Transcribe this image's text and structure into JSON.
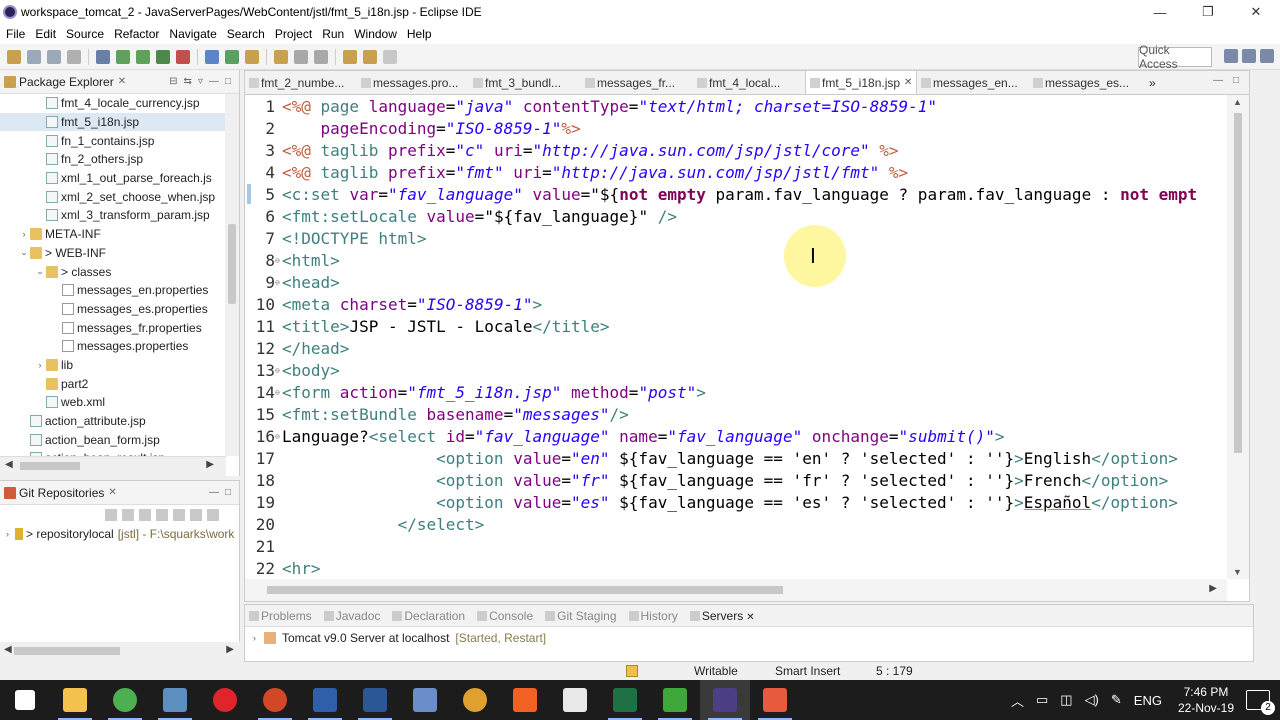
{
  "window": {
    "title": "workspace_tomcat_2 - JavaServerPages/WebContent/jstl/fmt_5_i18n.jsp - Eclipse IDE",
    "minimize": "—",
    "maximize": "❐",
    "close": "✕"
  },
  "menubar": [
    "File",
    "Edit",
    "Source",
    "Refactor",
    "Navigate",
    "Search",
    "Project",
    "Run",
    "Window",
    "Help"
  ],
  "toolbar": {
    "quick_access": "Quick Access"
  },
  "package_explorer": {
    "title": "Package Explorer",
    "items": [
      {
        "label": "fmt_4_locale_currency.jsp",
        "indent": 3,
        "icon": "file-icon",
        "twisty": ""
      },
      {
        "label": "fmt_5_i18n.jsp",
        "indent": 3,
        "icon": "file-icon",
        "twisty": "",
        "selected": true
      },
      {
        "label": "fn_1_contains.jsp",
        "indent": 3,
        "icon": "file-icon",
        "twisty": ""
      },
      {
        "label": "fn_2_others.jsp",
        "indent": 3,
        "icon": "file-icon",
        "twisty": ""
      },
      {
        "label": "xml_1_out_parse_foreach.js",
        "indent": 3,
        "icon": "file-icon",
        "twisty": ""
      },
      {
        "label": "xml_2_set_choose_when.jsp",
        "indent": 3,
        "icon": "file-icon",
        "twisty": ""
      },
      {
        "label": "xml_3_transform_param.jsp",
        "indent": 3,
        "icon": "file-icon",
        "twisty": ""
      },
      {
        "label": "META-INF",
        "indent": 2,
        "icon": "folder-icon",
        "twisty": "›"
      },
      {
        "label": "> WEB-INF",
        "indent": 2,
        "icon": "folder-icon",
        "twisty": "⌄"
      },
      {
        "label": "> classes",
        "indent": 3,
        "icon": "folder-icon",
        "twisty": "⌄"
      },
      {
        "label": "messages_en.properties",
        "indent": 4,
        "icon": "properties-icon",
        "twisty": ""
      },
      {
        "label": "messages_es.properties",
        "indent": 4,
        "icon": "properties-icon",
        "twisty": ""
      },
      {
        "label": "messages_fr.properties",
        "indent": 4,
        "icon": "properties-icon",
        "twisty": ""
      },
      {
        "label": "messages.properties",
        "indent": 4,
        "icon": "properties-icon",
        "twisty": ""
      },
      {
        "label": "lib",
        "indent": 3,
        "icon": "folder-icon",
        "twisty": "›"
      },
      {
        "label": "part2",
        "indent": 3,
        "icon": "folder-icon",
        "twisty": ""
      },
      {
        "label": "web.xml",
        "indent": 3,
        "icon": "file-icon",
        "twisty": ""
      },
      {
        "label": "action_attribute.jsp",
        "indent": 2,
        "icon": "file-icon",
        "twisty": ""
      },
      {
        "label": "action_bean_form.jsp",
        "indent": 2,
        "icon": "file-icon",
        "twisty": ""
      },
      {
        "label": "action_bean_result.jsp",
        "indent": 2,
        "icon": "file-icon",
        "twisty": ""
      }
    ]
  },
  "git_repositories": {
    "title": "Git Repositories",
    "repo_label": "> repositorylocal",
    "repo_detail": "[jstl] - F:\\squarks\\work"
  },
  "editor": {
    "tabs": [
      {
        "label": "fmt_2_numbe...",
        "active": false
      },
      {
        "label": "messages.pro...",
        "active": false
      },
      {
        "label": "fmt_3_bundl...",
        "active": false
      },
      {
        "label": "messages_fr...",
        "active": false
      },
      {
        "label": "fmt_4_local...",
        "active": false
      },
      {
        "label": "fmt_5_i18n.jsp",
        "active": true
      },
      {
        "label": "messages_en...",
        "active": false
      },
      {
        "label": "messages_es...",
        "active": false
      }
    ],
    "overflow": "»",
    "current_line": 5,
    "lines": [
      {
        "n": "1",
        "fold": false,
        "spans": [
          [
            "<%@ ",
            "#bf5f3f"
          ],
          [
            "page ",
            "#3f7f7f"
          ],
          [
            "language",
            "#7f007f"
          ],
          [
            "=",
            "#000000"
          ],
          [
            "\"java\"",
            "#2a00ff",
            "i"
          ],
          [
            " contentType",
            "#7f007f"
          ],
          [
            "=",
            "#000000"
          ],
          [
            "\"text/html; charset=ISO-8859-1\"",
            "#2a00ff",
            "i"
          ]
        ]
      },
      {
        "n": "2",
        "fold": false,
        "spans": [
          [
            "    pageEncoding",
            "#7f007f"
          ],
          [
            "=",
            "#000000"
          ],
          [
            "\"ISO-8859-1\"",
            "#2a00ff",
            "i"
          ],
          [
            "%>",
            "#bf5f3f"
          ]
        ]
      },
      {
        "n": "3",
        "fold": false,
        "spans": [
          [
            "<%@ ",
            "#bf5f3f"
          ],
          [
            "taglib ",
            "#3f7f7f"
          ],
          [
            "prefix",
            "#7f007f"
          ],
          [
            "=",
            "#000000"
          ],
          [
            "\"c\"",
            "#2a00ff",
            "i"
          ],
          [
            " uri",
            "#7f007f"
          ],
          [
            "=",
            "#000000"
          ],
          [
            "\"http://java.sun.com/jsp/jstl/core\"",
            "#2a00ff",
            "i"
          ],
          [
            " %>",
            "#bf5f3f"
          ]
        ]
      },
      {
        "n": "4",
        "fold": false,
        "spans": [
          [
            "<%@ ",
            "#bf5f3f"
          ],
          [
            "taglib ",
            "#3f7f7f"
          ],
          [
            "prefix",
            "#7f007f"
          ],
          [
            "=",
            "#000000"
          ],
          [
            "\"fmt\"",
            "#2a00ff",
            "i"
          ],
          [
            " uri",
            "#7f007f"
          ],
          [
            "=",
            "#000000"
          ],
          [
            "\"http://java.sun.com/jsp/jstl/fmt\"",
            "#2a00ff",
            "i"
          ],
          [
            " %>",
            "#bf5f3f"
          ]
        ]
      },
      {
        "n": "5",
        "fold": false,
        "spans": [
          [
            "<c:set ",
            "#3f7f7f"
          ],
          [
            "var",
            "#7f007f"
          ],
          [
            "=",
            "#000000"
          ],
          [
            "\"fav_language\"",
            "#2a00ff",
            "i"
          ],
          [
            " value",
            "#7f007f"
          ],
          [
            "=",
            "#000000"
          ],
          [
            "\"${",
            "#000000"
          ],
          [
            "not empty ",
            "#7f0055",
            "b"
          ],
          [
            "param.fav_language ? param.fav_language : ",
            "#000000"
          ],
          [
            "not empt",
            "#7f0055",
            "b"
          ]
        ]
      },
      {
        "n": "6",
        "fold": false,
        "spans": [
          [
            "<fmt:setLocale ",
            "#3f7f7f"
          ],
          [
            "value",
            "#7f007f"
          ],
          [
            "=",
            "#000000"
          ],
          [
            "\"${fav_language}\"",
            "#000000"
          ],
          [
            " />",
            "#3f7f7f"
          ]
        ]
      },
      {
        "n": "7",
        "fold": false,
        "spans": [
          [
            "<!DOCTYPE html>",
            "#3f7f7f"
          ]
        ]
      },
      {
        "n": "8",
        "fold": true,
        "spans": [
          [
            "<html>",
            "#3f7f7f"
          ]
        ]
      },
      {
        "n": "9",
        "fold": true,
        "spans": [
          [
            "<head>",
            "#3f7f7f"
          ]
        ]
      },
      {
        "n": "10",
        "fold": false,
        "spans": [
          [
            "<meta ",
            "#3f7f7f"
          ],
          [
            "charset",
            "#7f007f"
          ],
          [
            "=",
            "#000000"
          ],
          [
            "\"ISO-8859-1\"",
            "#2a00ff",
            "i"
          ],
          [
            ">",
            "#3f7f7f"
          ]
        ]
      },
      {
        "n": "11",
        "fold": false,
        "spans": [
          [
            "<title>",
            "#3f7f7f"
          ],
          [
            "JSP - JSTL - Locale",
            "#000000"
          ],
          [
            "</title>",
            "#3f7f7f"
          ]
        ]
      },
      {
        "n": "12",
        "fold": false,
        "spans": [
          [
            "</head>",
            "#3f7f7f"
          ]
        ]
      },
      {
        "n": "13",
        "fold": true,
        "spans": [
          [
            "<body>",
            "#3f7f7f"
          ]
        ]
      },
      {
        "n": "14",
        "fold": true,
        "spans": [
          [
            "<form ",
            "#3f7f7f"
          ],
          [
            "action",
            "#7f007f"
          ],
          [
            "=",
            "#000000"
          ],
          [
            "\"fmt_5_i18n.jsp\"",
            "#2a00ff",
            "i"
          ],
          [
            " method",
            "#7f007f"
          ],
          [
            "=",
            "#000000"
          ],
          [
            "\"post\"",
            "#2a00ff",
            "i"
          ],
          [
            ">",
            "#3f7f7f"
          ]
        ]
      },
      {
        "n": "15",
        "fold": false,
        "spans": [
          [
            "<fmt:setBundle ",
            "#3f7f7f"
          ],
          [
            "basename",
            "#7f007f"
          ],
          [
            "=",
            "#000000"
          ],
          [
            "\"messages\"",
            "#2a00ff",
            "i"
          ],
          [
            "/>",
            "#3f7f7f"
          ]
        ]
      },
      {
        "n": "16",
        "fold": true,
        "spans": [
          [
            "Language?",
            "#000000"
          ],
          [
            "<select ",
            "#3f7f7f"
          ],
          [
            "id",
            "#7f007f"
          ],
          [
            "=",
            "#000000"
          ],
          [
            "\"fav_language\"",
            "#2a00ff",
            "i"
          ],
          [
            " name",
            "#7f007f"
          ],
          [
            "=",
            "#000000"
          ],
          [
            "\"fav_language\"",
            "#2a00ff",
            "i"
          ],
          [
            " onchange",
            "#7f007f"
          ],
          [
            "=",
            "#000000"
          ],
          [
            "\"submit()\"",
            "#2a00ff",
            "i"
          ],
          [
            ">",
            "#3f7f7f"
          ]
        ]
      },
      {
        "n": "17",
        "fold": false,
        "spans": [
          [
            "                ",
            "#000000"
          ],
          [
            "<option ",
            "#3f7f7f"
          ],
          [
            "value",
            "#7f007f"
          ],
          [
            "=",
            "#000000"
          ],
          [
            "\"en\"",
            "#2a00ff",
            "i"
          ],
          [
            " ${fav_language == 'en' ? 'selected' : ''}",
            "#000000"
          ],
          [
            ">",
            "#3f7f7f"
          ],
          [
            "English",
            "#000000"
          ],
          [
            "</option>",
            "#3f7f7f"
          ]
        ]
      },
      {
        "n": "18",
        "fold": false,
        "spans": [
          [
            "                ",
            "#000000"
          ],
          [
            "<option ",
            "#3f7f7f"
          ],
          [
            "value",
            "#7f007f"
          ],
          [
            "=",
            "#000000"
          ],
          [
            "\"fr\"",
            "#2a00ff",
            "i"
          ],
          [
            " ${fav_language == 'fr' ? 'selected' : ''}",
            "#000000"
          ],
          [
            ">",
            "#3f7f7f"
          ],
          [
            "French",
            "#000000"
          ],
          [
            "</option>",
            "#3f7f7f"
          ]
        ]
      },
      {
        "n": "19",
        "fold": false,
        "spans": [
          [
            "                ",
            "#000000"
          ],
          [
            "<option ",
            "#3f7f7f"
          ],
          [
            "value",
            "#7f007f"
          ],
          [
            "=",
            "#000000"
          ],
          [
            "\"es\"",
            "#2a00ff",
            "i"
          ],
          [
            " ${fav_language == 'es' ? 'selected' : ''}",
            "#000000"
          ],
          [
            ">",
            "#3f7f7f"
          ],
          [
            "Español",
            "#000000",
            "u"
          ],
          [
            "</option>",
            "#3f7f7f"
          ]
        ]
      },
      {
        "n": "20",
        "fold": false,
        "spans": [
          [
            "            ",
            "#000000"
          ],
          [
            "</select>",
            "#3f7f7f"
          ]
        ]
      },
      {
        "n": "21",
        "fold": false,
        "spans": []
      },
      {
        "n": "22",
        "fold": false,
        "spans": [
          [
            "<hr>",
            "#3f7f7f"
          ]
        ]
      }
    ]
  },
  "bottom_panel": {
    "tabs": [
      {
        "label": "Problems",
        "active": false
      },
      {
        "label": "Javadoc",
        "active": false
      },
      {
        "label": "Declaration",
        "active": false
      },
      {
        "label": "Console",
        "active": false
      },
      {
        "label": "Git Staging",
        "active": false
      },
      {
        "label": "History",
        "active": false
      },
      {
        "label": "Servers",
        "active": true
      }
    ],
    "server_name": "Tomcat v9.0 Server at localhost",
    "server_status": "[Started, Restart]"
  },
  "status_bar": {
    "writable": "Writable",
    "insert_mode": "Smart Insert",
    "position": "5 : 179"
  },
  "taskbar": {
    "apps": [
      {
        "name": "windows-start-icon",
        "color": "#ffffff",
        "running": false,
        "active": false
      },
      {
        "name": "file-explorer-icon",
        "color": "#f2c14e",
        "running": true,
        "active": false
      },
      {
        "name": "chrome-icon",
        "color": "#4caf50",
        "running": true,
        "active": false
      },
      {
        "name": "screen-recorder-icon",
        "color": "#5a8fbf",
        "running": true,
        "active": false
      },
      {
        "name": "opera-icon",
        "color": "#e0242b",
        "running": false,
        "active": false
      },
      {
        "name": "powerpoint-icon",
        "color": "#d24726",
        "running": true,
        "active": false
      },
      {
        "name": "powershell-icon",
        "color": "#2f5fa8",
        "running": true,
        "active": false
      },
      {
        "name": "word-icon",
        "color": "#2b5797",
        "running": true,
        "active": false
      },
      {
        "name": "network-tool-icon",
        "color": "#6a8cc8",
        "running": false,
        "active": false
      },
      {
        "name": "globe-app-icon",
        "color": "#e0a030",
        "running": false,
        "active": false
      },
      {
        "name": "brave-icon",
        "color": "#f26024",
        "running": false,
        "active": false
      },
      {
        "name": "mail-icon",
        "color": "#e8e8e8",
        "running": false,
        "active": false
      },
      {
        "name": "excel-icon",
        "color": "#1e7145",
        "running": true,
        "active": false
      },
      {
        "name": "camtasia-icon",
        "color": "#3fa83a",
        "running": true,
        "active": false
      },
      {
        "name": "eclipse-icon",
        "color": "#4c3f85",
        "running": true,
        "active": true
      },
      {
        "name": "camtasia-recorder-icon",
        "color": "#e85a3c",
        "running": true,
        "active": false
      }
    ],
    "language": "ENG",
    "time": "7:46 PM",
    "date": "22-Nov-19",
    "notification_count": "2"
  }
}
